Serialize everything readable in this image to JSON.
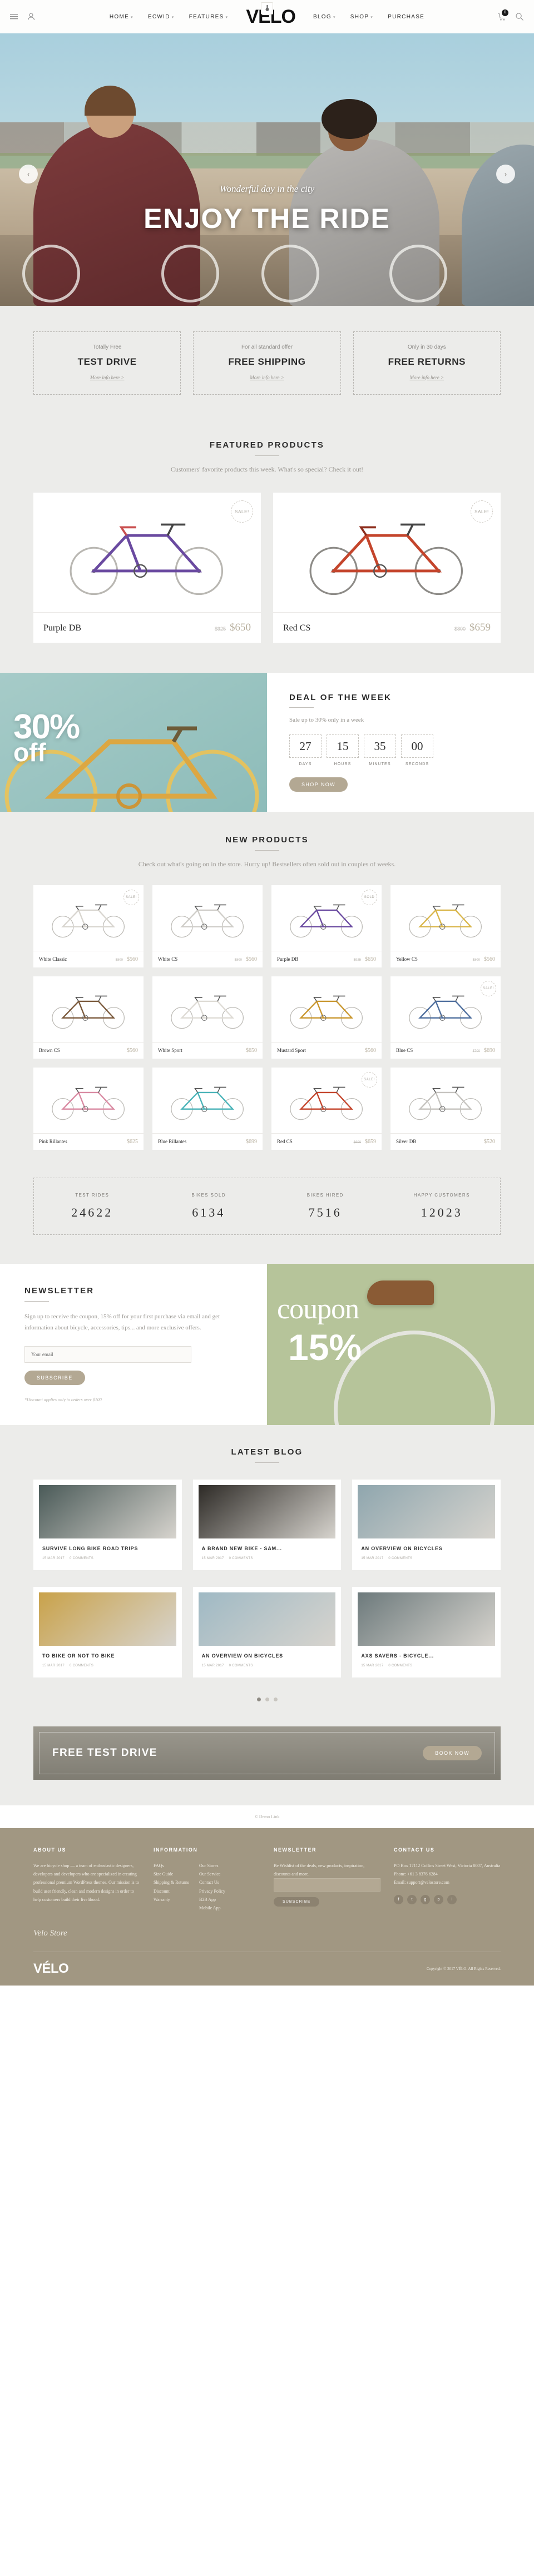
{
  "header": {
    "logo": "VÉLO",
    "nav": [
      {
        "label": "HOME",
        "caret": "▾"
      },
      {
        "label": "ECWID",
        "caret": "▾"
      },
      {
        "label": "FEATURES",
        "caret": "▾"
      },
      {
        "label": "BLOG",
        "caret": "▾"
      },
      {
        "label": "SHOP",
        "caret": "▾"
      },
      {
        "label": "PURCHASE",
        "caret": ""
      }
    ],
    "cart_count": "0"
  },
  "hero": {
    "subtitle": "Wonderful day in the city",
    "title": "ENJOY THE RIDE",
    "prev": "‹",
    "next": "›"
  },
  "promos": [
    {
      "top": "Totally Free",
      "head": "TEST DRIVE",
      "link": "More info here >"
    },
    {
      "top": "For all standard offer",
      "head": "FREE SHIPPING",
      "link": "More info here >"
    },
    {
      "top": "Only in 30 days",
      "head": "FREE RETURNS",
      "link": "More info here >"
    }
  ],
  "featured": {
    "title": "FEATURED PRODUCTS",
    "subtitle": "Customers' favorite products this week. What's so special? Check it out!",
    "items": [
      {
        "name": "Purple DB",
        "old": "$925",
        "price": "$650",
        "badge": "SALE!",
        "color": "#6a4aa0",
        "accent": "#c94f4f"
      },
      {
        "name": "Red CS",
        "old": "$800",
        "price": "$659",
        "badge": "SALE!",
        "color": "#c4452c",
        "accent": "#8d2d1c"
      }
    ]
  },
  "deal": {
    "off_big": "30%",
    "off_small": "off",
    "title": "DEAL OF THE WEEK",
    "subtitle": "Sale up to 30% only in a week",
    "counters": [
      {
        "value": "27",
        "label": "DAYS"
      },
      {
        "value": "15",
        "label": "HOURS"
      },
      {
        "value": "35",
        "label": "MINUTES"
      },
      {
        "value": "00",
        "label": "SECONDS"
      }
    ],
    "button": "SHOP NOW"
  },
  "newproducts": {
    "title": "NEW PRODUCTS",
    "subtitle": "Check out what's going on in the store. Hurry up! Bestsellers often sold out in couples of weeks.",
    "items": [
      {
        "name": "White Classic",
        "old": "$800",
        "price": "$560",
        "badge": "SALE!",
        "color": "#d8d5cf"
      },
      {
        "name": "White CS",
        "old": "$800",
        "price": "$560",
        "badge": "",
        "color": "#cfcdc8"
      },
      {
        "name": "Purple DB",
        "old": "$925",
        "price": "$650",
        "badge": "SOLD",
        "color": "#6a4aa0"
      },
      {
        "name": "Yellow CS",
        "old": "$800",
        "price": "$560",
        "badge": "",
        "color": "#d9b64a"
      },
      {
        "name": "Brown CS",
        "old": "",
        "price": "$560",
        "badge": "",
        "color": "#7b5a3c"
      },
      {
        "name": "White Sport",
        "old": "",
        "price": "$650",
        "badge": "",
        "color": "#dedbd5"
      },
      {
        "name": "Mustard Sport",
        "old": "",
        "price": "$560",
        "badge": "",
        "color": "#c9972f"
      },
      {
        "name": "Blue CS",
        "old": "$700",
        "price": "$690",
        "badge": "SALE!",
        "color": "#4f6f9e"
      },
      {
        "name": "Pink Rillantes",
        "old": "",
        "price": "$625",
        "badge": "",
        "color": "#d98aa2"
      },
      {
        "name": "Blue Rillantes",
        "old": "",
        "price": "$699",
        "badge": "",
        "color": "#49b3b8"
      },
      {
        "name": "Red CS",
        "old": "$800",
        "price": "$659",
        "badge": "SALE!",
        "color": "#c4452c"
      },
      {
        "name": "Silver DB",
        "old": "",
        "price": "$520",
        "badge": "",
        "color": "#c5c3bf"
      }
    ]
  },
  "stats": [
    {
      "label": "TEST RIDES",
      "value": "24622"
    },
    {
      "label": "BIKES SOLD",
      "value": "6134"
    },
    {
      "label": "BIKES HIRED",
      "value": "7516"
    },
    {
      "label": "HAPPY CUSTOMERS",
      "value": "12023"
    }
  ],
  "newsletter": {
    "title": "NEWSLETTER",
    "copy": "Sign up to receive the coupon, 15% off for your first purchase via email and get information about bicycle, accessories, tips... and more exclusive offers.",
    "placeholder": "Your email",
    "button": "SUBSCRIBE",
    "note": "*Discount applies only to orders over $100",
    "coupon_top": "coupon",
    "coupon_bottom": "15%"
  },
  "blog": {
    "title": "LATEST BLOG",
    "posts": [
      {
        "title": "SURVIVE LONG BIKE ROAD TRIPS",
        "date": "15 MAR 2017",
        "comments": "0 COMMENTS",
        "tone": "#4a5a58"
      },
      {
        "title": "A BRAND NEW BIKE - SAM...",
        "date": "15 MAR 2017",
        "comments": "0 COMMENTS",
        "tone": "#2d2a26"
      },
      {
        "title": "AN OVERVIEW ON BICYCLES",
        "date": "15 MAR 2017",
        "comments": "0 COMMENTS",
        "tone": "#8fa6ae"
      },
      {
        "title": "TO BIKE OR NOT TO BIKE",
        "date": "15 MAR 2017",
        "comments": "0 COMMENTS",
        "tone": "#c9a24a"
      },
      {
        "title": "AN OVERVIEW ON BICYCLES",
        "date": "15 MAR 2017",
        "comments": "0 COMMENTS",
        "tone": "#9fb9c4"
      },
      {
        "title": "AXS SAVERS - BICYCLE...",
        "date": "15 MAR 2017",
        "comments": "0 COMMENTS",
        "tone": "#6d7a7c"
      }
    ],
    "dots": 3,
    "active_dot": 0
  },
  "cta": {
    "title": "FREE TEST DRIVE",
    "button": "BOOK NOW"
  },
  "footer": {
    "credit": "© Demo Link",
    "about": {
      "head": "ABOUT US",
      "text": "We are bicycle shop — a team of enthusiastic designers, developers and developers who are specialized in creating professional premium WordPress themes. Our mission is to build user friendly, clean and modern designs in order to help customers build their livelihood."
    },
    "information": {
      "head": "INFORMATION",
      "col1": [
        "FAQs",
        "Size Guide",
        "Shipping & Returns",
        "Discount",
        "Warranty"
      ],
      "col2": [
        "Our Stores",
        "Our Service",
        "Contact Us",
        "Privacy Policy",
        "B2B App",
        "Mobile App"
      ]
    },
    "newsletter": {
      "head": "NEWSLETTER",
      "text": "Be Wishlist of the deals, new products, inspiration, discounts and more.",
      "button": "SUBSCRIBE"
    },
    "contact": {
      "head": "CONTACT US",
      "address": "PO Box 17112 Collins Street West, Victoria 8007, Australia",
      "phone": "Phone: +61 3 8376 6284",
      "email": "Email: support@velostore.com"
    },
    "signature": "Velo Store",
    "logo": "VÉLO",
    "copyright": "Copyright © 2017 VÉLO. All Rights Reserved."
  }
}
